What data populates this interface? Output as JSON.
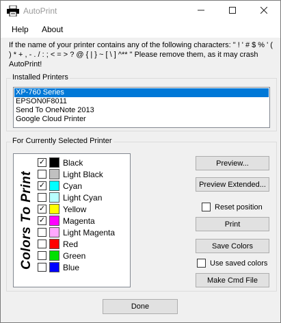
{
  "window": {
    "title": "AutoPrint"
  },
  "menu": {
    "items": [
      "Help",
      "About"
    ]
  },
  "warning": "If the name of your printer contains any of the following characters: \" ! ' # $ %  ' ( ) * + , - . / : ; < = > ? @ { | } ~ [ \\ ] ^** \" Please remove them, as it may crash AutoPrint!",
  "printers": {
    "label": "Installed Printers",
    "items": [
      "XP-760 Series",
      "EPSON0F8011",
      "Send To OneNote 2013",
      "Google Cloud Printer"
    ],
    "selected": "XP-760 Series"
  },
  "colors_group": {
    "label": "For Currently Selected Printer",
    "vertical_title": "Colors To Print",
    "colors": [
      {
        "name": "Black",
        "checked": true,
        "swatch": "#000000"
      },
      {
        "name": "Light Black",
        "checked": false,
        "swatch": "#c0c0c0"
      },
      {
        "name": "Cyan",
        "checked": true,
        "swatch": "#00ffff"
      },
      {
        "name": "Light Cyan",
        "checked": false,
        "swatch": "#b8ffff"
      },
      {
        "name": "Yellow",
        "checked": true,
        "swatch": "#ffff00"
      },
      {
        "name": "Magenta",
        "checked": true,
        "swatch": "#ff00ff"
      },
      {
        "name": "Light Magenta",
        "checked": false,
        "swatch": "#ffa8ff"
      },
      {
        "name": "Red",
        "checked": false,
        "swatch": "#ff0000"
      },
      {
        "name": "Green",
        "checked": false,
        "swatch": "#00e000"
      },
      {
        "name": "Blue",
        "checked": false,
        "swatch": "#0000ff"
      }
    ]
  },
  "buttons": {
    "preview": "Preview...",
    "preview_extended": "Preview Extended...",
    "print": "Print",
    "save_colors": "Save Colors",
    "make_cmd_file": "Make Cmd File",
    "done": "Done"
  },
  "checkboxes": {
    "reset_position": {
      "label": "Reset position",
      "checked": false
    },
    "use_saved_colors": {
      "label": "Use saved colors",
      "checked": false
    }
  },
  "icons": {
    "app": "printer-icon",
    "minimize": "minimize-icon",
    "maximize": "maximize-icon",
    "close": "close-icon"
  }
}
